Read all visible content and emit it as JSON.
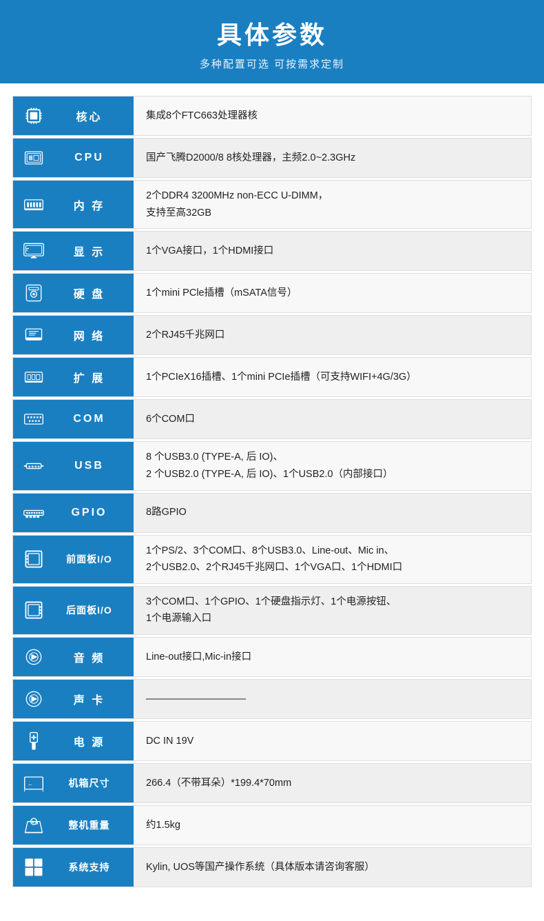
{
  "header": {
    "title": "具体参数",
    "subtitle": "多种配置可选 可按需求定制"
  },
  "specs": [
    {
      "id": "core",
      "label": "核心",
      "value": "集成8个FTC663处理器核"
    },
    {
      "id": "cpu",
      "label": "CPU",
      "value": "国产飞腾D2000/8  8核处理器，主频2.0~2.3GHz"
    },
    {
      "id": "memory",
      "label": "内 存",
      "value": "2个DDR4 3200MHz non-ECC U-DIMM，\n支持至高32GB"
    },
    {
      "id": "display",
      "label": "显 示",
      "value": "1个VGA接口，1个HDMI接口"
    },
    {
      "id": "hdd",
      "label": "硬 盘",
      "value": "1个mini PCle插槽（mSATA信号）"
    },
    {
      "id": "network",
      "label": "网 络",
      "value": "2个RJ45千兆网口"
    },
    {
      "id": "expansion",
      "label": "扩 展",
      "value": "1个PCIeX16插槽、1个mini PCIe插槽（可支持WIFI+4G/3G）"
    },
    {
      "id": "com",
      "label": "COM",
      "value": "6个COM口"
    },
    {
      "id": "usb",
      "label": "USB",
      "value": "8 个USB3.0 (TYPE-A, 后 IO)、\n2 个USB2.0 (TYPE-A, 后 IO)、1个USB2.0（内部接口）"
    },
    {
      "id": "gpio",
      "label": "GPIO",
      "value": "8路GPIO"
    },
    {
      "id": "front-io",
      "label": "前面板I/O",
      "value": "1个PS/2、3个COM口、8个USB3.0、Line-out、Mic in、\n2个USB2.0、2个RJ45千兆网口、1个VGA口、1个HDMI口"
    },
    {
      "id": "rear-io",
      "label": "后面板I/O",
      "value": "3个COM口、1个GPIO、1个硬盘指示灯、1个电源按钮、\n1个电源输入口"
    },
    {
      "id": "audio",
      "label": "音 频",
      "value": "Line-out接口,Mic-in接口"
    },
    {
      "id": "soundcard",
      "label": "声 卡",
      "value": "——————————"
    },
    {
      "id": "power",
      "label": "电 源",
      "value": "DC IN 19V"
    },
    {
      "id": "dimensions",
      "label": "机箱尺寸",
      "value": "266.4（不带耳朵）*199.4*70mm"
    },
    {
      "id": "weight",
      "label": "整机重量",
      "value": "约1.5kg"
    },
    {
      "id": "os",
      "label": "系统支持",
      "value": "Kylin, UOS等国产操作系统（具体版本请咨询客服）"
    }
  ]
}
